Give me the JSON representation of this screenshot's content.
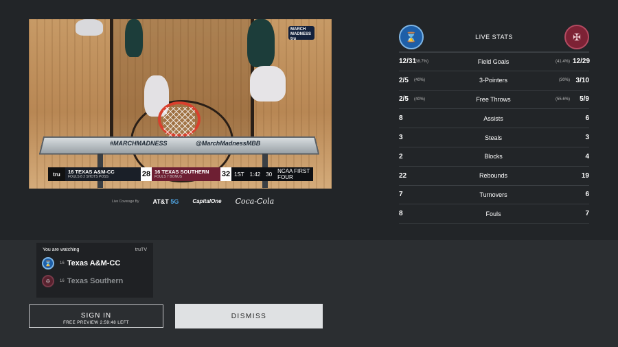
{
  "video": {
    "backboard_left": "#MARCHMADNESS",
    "backboard_right": "@MarchMadnessMBB",
    "mm_logo": "MARCH MADNESS tru",
    "scorebug": {
      "network": "tru",
      "team_a_name": "16 TEXAS A&M-CC",
      "team_a_sub": "FOULS 8    2 SHOTS    POSS",
      "team_a_score": "28",
      "team_b_name": "16 TEXAS SOUTHERN",
      "team_b_sub": "FOULS 7    BONUS",
      "team_b_score": "32",
      "period": "1ST",
      "clock": "1:42",
      "shot_clock": "30",
      "event": "NCAA FIRST FOUR"
    }
  },
  "sponsors": {
    "label": "Live Coverage By",
    "att": "AT&T",
    "att_5g": "5G",
    "capone": "CapitalOne",
    "coke": "Coca-Cola"
  },
  "stats": {
    "title": "LIVE STATS",
    "rows": [
      {
        "left": "12/31",
        "left_pct": "(38.7%)",
        "label": "Field Goals",
        "right_pct": "(41.4%)",
        "right": "12/29"
      },
      {
        "left": "2/5",
        "left_pct": "(40%)",
        "label": "3-Pointers",
        "right_pct": "(30%)",
        "right": "3/10"
      },
      {
        "left": "2/5",
        "left_pct": "(40%)",
        "label": "Free Throws",
        "right_pct": "(55.6%)",
        "right": "5/9"
      },
      {
        "left": "8",
        "left_pct": "",
        "label": "Assists",
        "right_pct": "",
        "right": "6"
      },
      {
        "left": "3",
        "left_pct": "",
        "label": "Steals",
        "right_pct": "",
        "right": "3"
      },
      {
        "left": "2",
        "left_pct": "",
        "label": "Blocks",
        "right_pct": "",
        "right": "4"
      },
      {
        "left": "22",
        "left_pct": "",
        "label": "Rebounds",
        "right_pct": "",
        "right": "19"
      },
      {
        "left": "7",
        "left_pct": "",
        "label": "Turnovers",
        "right_pct": "",
        "right": "6"
      },
      {
        "left": "8",
        "left_pct": "",
        "label": "Fouls",
        "right_pct": "",
        "right": "7"
      }
    ]
  },
  "watching": {
    "title": "You are watching",
    "network": "truTV",
    "team_a_seed": "16",
    "team_a_name": "Texas A&M-CC",
    "team_b_seed": "16",
    "team_b_name": "Texas Southern"
  },
  "buttons": {
    "sign_in": "SIGN IN",
    "preview": "FREE PREVIEW 2:59:48 LEFT",
    "dismiss": "DISMISS"
  },
  "colors": {
    "team_a": "#1e5fa8",
    "team_b": "#7d2235",
    "background": "#222528"
  }
}
